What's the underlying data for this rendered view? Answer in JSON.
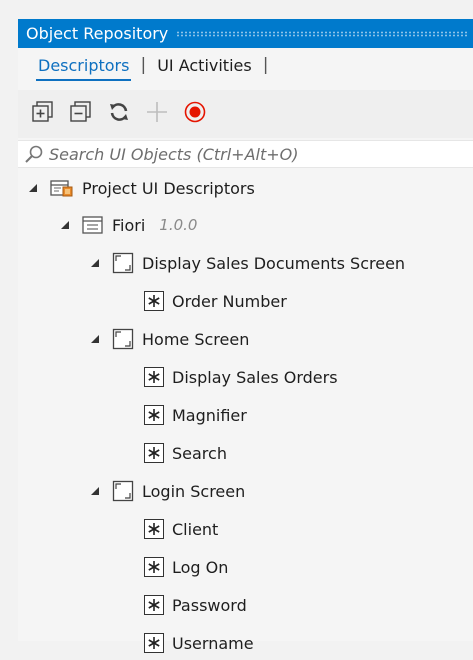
{
  "panel": {
    "title": "Object Repository"
  },
  "tabs": [
    {
      "label": "Descriptors",
      "active": true
    },
    {
      "label": "UI Activities",
      "active": false
    }
  ],
  "toolbar": {
    "items": [
      "expand-all-icon",
      "collapse-all-icon",
      "refresh-icon",
      "add-icon",
      "record-icon"
    ],
    "record_color": "#e51400"
  },
  "search": {
    "placeholder": "Search UI Objects (Ctrl+Alt+O)",
    "value": ""
  },
  "tree": {
    "root": {
      "label": "Project UI Descriptors"
    },
    "library": {
      "label": "Fiori",
      "version": "1.0.0"
    },
    "screens": [
      {
        "label": "Display Sales Documents Screen",
        "elements": [
          "Order Number"
        ]
      },
      {
        "label": "Home Screen",
        "elements": [
          "Display Sales Orders",
          "Magnifier",
          "Search"
        ]
      },
      {
        "label": "Login Screen",
        "elements": [
          "Client",
          "Log On",
          "Password",
          "Username"
        ]
      }
    ]
  },
  "colors": {
    "accent": "#007acc",
    "tab_active": "#0e70c0"
  }
}
